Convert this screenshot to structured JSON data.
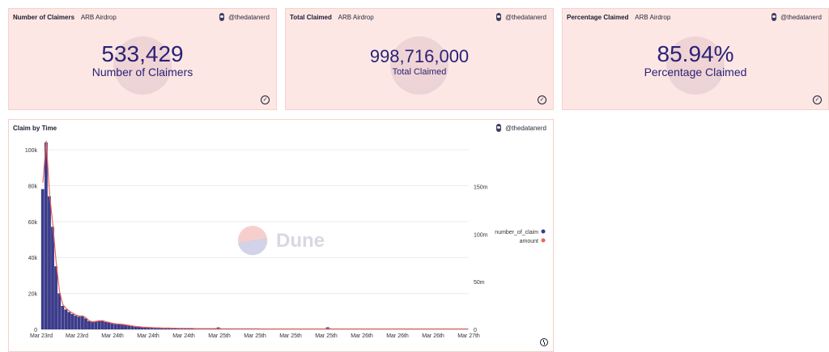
{
  "cards": [
    {
      "title": "Number of Claimers",
      "subtitle": "ARB Airdrop",
      "author": "@thedatanerd",
      "value": "533,429",
      "label": "Number of Claimers"
    },
    {
      "title": "Total Claimed",
      "subtitle": "ARB Airdrop",
      "author": "@thedatanerd",
      "value": "998,716,000",
      "label": "Total Claimed"
    },
    {
      "title": "Percentage Claimed",
      "subtitle": "ARB Airdrop",
      "author": "@thedatanerd",
      "value": "85.94%",
      "label": "Percentage Claimed"
    }
  ],
  "chart_card": {
    "title": "Claim by Time",
    "author": "@thedatanerd",
    "watermark": "Dune"
  },
  "chart_data": {
    "type": "bar",
    "title": "Claim by Time",
    "x_tick_labels": [
      "Mar 23rd",
      "Mar 23rd",
      "Mar 24th",
      "Mar 24th",
      "Mar 24th",
      "Mar 25th",
      "Mar 25th",
      "Mar 25th",
      "Mar 25th",
      "Mar 26th",
      "Mar 26th",
      "Mar 26th",
      "Mar 27th"
    ],
    "y_left": {
      "ticks": [
        0,
        20000,
        40000,
        60000,
        80000,
        100000
      ],
      "tick_labels": [
        "0",
        "20k",
        "40k",
        "60k",
        "80k",
        "100k"
      ],
      "ylim": [
        0,
        105000
      ]
    },
    "y_right": {
      "ticks": [
        0,
        50000000,
        100000000,
        150000000
      ],
      "tick_labels": [
        "0",
        "50m",
        "100m",
        "150m"
      ],
      "ylim": [
        0,
        198000000
      ]
    },
    "series": [
      {
        "name": "number_of_claim",
        "color": "#3b3b8f",
        "axis": "left",
        "values": [
          78000,
          104000,
          74000,
          57000,
          35000,
          20000,
          13000,
          11000,
          9500,
          8500,
          7500,
          7000,
          7200,
          6000,
          4500,
          4000,
          4200,
          4500,
          4600,
          4000,
          3700,
          3200,
          2900,
          2800,
          2600,
          2400,
          2100,
          1800,
          1500,
          1400,
          1200,
          1100,
          1000,
          900,
          800,
          800,
          700,
          700,
          700,
          600,
          600,
          500,
          500,
          500,
          500,
          500,
          400,
          400,
          400,
          400,
          400,
          400,
          400,
          1000,
          300,
          300,
          300,
          300,
          300,
          300,
          300,
          300,
          300,
          300,
          300,
          300,
          200,
          200,
          200,
          200,
          200,
          200,
          200,
          200,
          200,
          200,
          200,
          200,
          200,
          200,
          200,
          200,
          200,
          200,
          200,
          200,
          1100,
          200,
          200,
          200,
          200,
          200,
          200,
          200,
          200,
          200,
          200,
          200,
          200,
          200,
          200,
          200,
          200,
          200,
          200,
          200,
          200,
          200,
          200,
          200,
          200,
          200,
          200,
          200,
          200,
          200,
          200,
          200,
          200,
          200,
          200,
          200,
          200,
          200,
          200,
          200,
          200,
          200,
          200
        ]
      },
      {
        "name": "amount",
        "color": "#e8635c",
        "axis": "right",
        "values": [
          154000000,
          198000000,
          142000000,
          110000000,
          70000000,
          40000000,
          26000000,
          22000000,
          19000000,
          17000000,
          15000000,
          14000000,
          14000000,
          12000000,
          9000000,
          8000000,
          8400000,
          9000000,
          9200000,
          8000000,
          7400000,
          6400000,
          5800000,
          5600000,
          5200000,
          4800000,
          4200000,
          3600000,
          3000000,
          2800000,
          2400000,
          2200000,
          2000000,
          1800000,
          1600000,
          1600000,
          1400000,
          1400000,
          1400000,
          1200000,
          1200000,
          1000000,
          1000000,
          1000000,
          1000000,
          1000000,
          800000,
          800000,
          800000,
          800000,
          800000,
          800000,
          800000,
          1000000,
          600000,
          600000,
          600000,
          600000,
          600000,
          600000,
          600000,
          600000,
          600000,
          600000,
          600000,
          600000,
          400000,
          400000,
          400000,
          400000,
          400000,
          400000,
          400000,
          400000,
          400000,
          400000,
          400000,
          400000,
          400000,
          400000,
          400000,
          400000,
          400000,
          400000,
          400000,
          400000,
          1200000,
          400000,
          400000,
          400000,
          400000,
          400000,
          400000,
          400000,
          400000,
          400000,
          400000,
          400000,
          400000,
          400000,
          400000,
          400000,
          400000,
          400000,
          400000,
          400000,
          400000,
          400000,
          400000,
          400000,
          400000,
          400000,
          400000,
          400000,
          400000,
          400000,
          400000,
          400000,
          400000,
          400000,
          400000,
          400000,
          400000,
          400000,
          400000,
          400000,
          400000,
          400000,
          400000
        ]
      }
    ],
    "legend": {
      "position": "right",
      "entries": [
        "number_of_claim",
        "amount"
      ]
    },
    "grid": true
  }
}
